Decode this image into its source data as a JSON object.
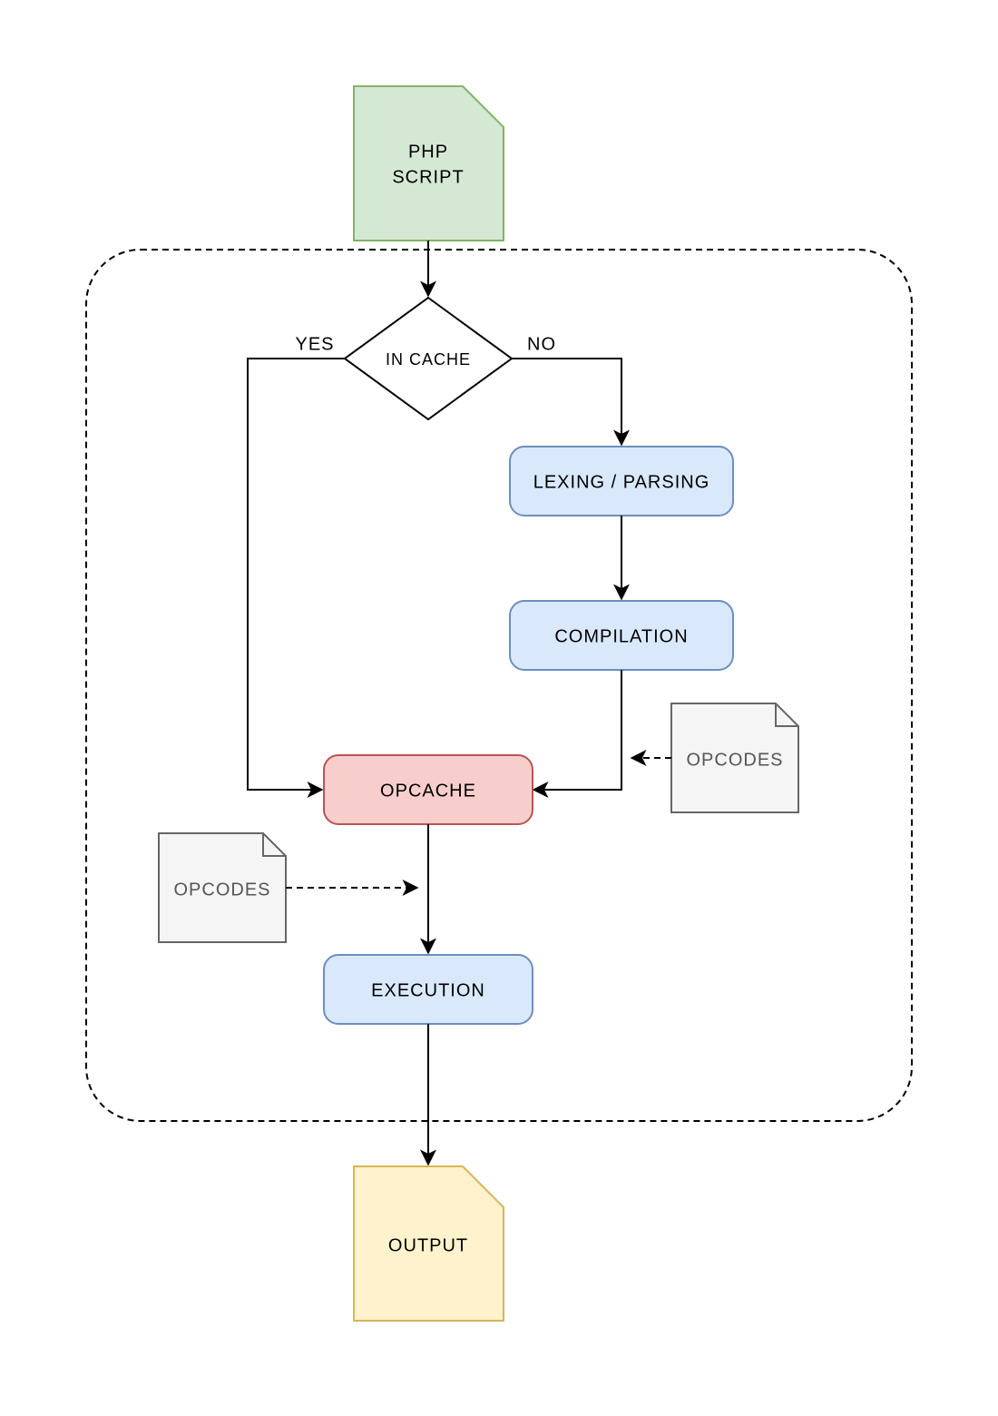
{
  "nodes": {
    "phpScript": {
      "line1": "PHP",
      "line2": "SCRIPT"
    },
    "inCache": {
      "label": "IN CACHE"
    },
    "lexing": {
      "label": "LEXING / PARSING"
    },
    "compilation": {
      "label": "COMPILATION"
    },
    "opcache": {
      "label": "OPCACHE"
    },
    "execution": {
      "label": "EXECUTION"
    },
    "output": {
      "label": "OUTPUT"
    },
    "opcodesR": {
      "label": "OPCODES"
    },
    "opcodesL": {
      "label": "OPCODES"
    }
  },
  "edges": {
    "yes": "YES",
    "no": "NO"
  },
  "colors": {
    "green_fill": "#d5e8d4",
    "green_stroke": "#82b366",
    "blue_fill": "#dae8fc",
    "blue_stroke": "#6c8ebf",
    "red_fill": "#f8cecc",
    "red_stroke": "#b85450",
    "yellow_fill": "#fff2cc",
    "yellow_stroke": "#d6b656",
    "note_fill": "#f5f5f5",
    "note_stroke": "#666666",
    "line": "#000000"
  }
}
